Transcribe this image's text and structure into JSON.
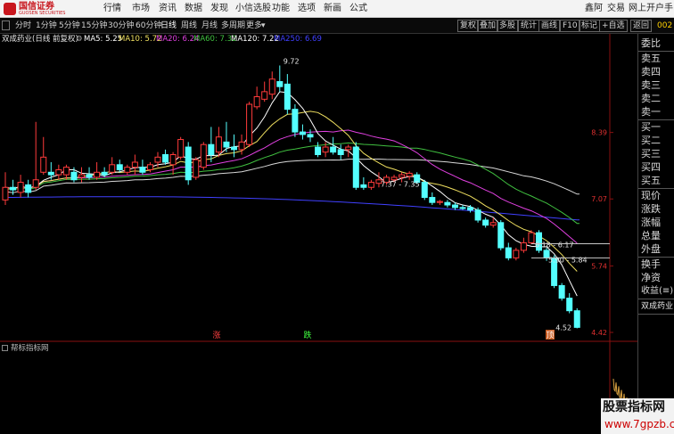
{
  "app": {
    "logo_text": "国信证券",
    "logo_sub": "GUOSEN SECURITIES",
    "menu": [
      "行情",
      "市场",
      "资讯",
      "数据",
      "发现",
      "小信选股",
      "功能",
      "选项",
      "新画",
      "公式"
    ],
    "menu_right": [
      "鑫阿",
      "交易",
      "网上开户",
      "手"
    ]
  },
  "toolbar": {
    "periods": [
      "分时",
      "1分钟",
      "5分钟",
      "15分钟",
      "30分钟",
      "60分钟",
      "日线",
      "周线",
      "月线",
      "多周期",
      "更多"
    ],
    "active_period": "日线",
    "buttons": [
      "复权",
      "叠加",
      "多股",
      "统计",
      "画线",
      "F10",
      "标记",
      "+自选",
      "返回"
    ],
    "code": "002"
  },
  "legend": {
    "title": "双成药业(日线 前复权)",
    "ma": [
      {
        "text": "MA5: 5.25",
        "color": "#ffffff"
      },
      {
        "text": "MA10: 5.72",
        "color": "#f0e060"
      },
      {
        "text": "MA20: 6.24",
        "color": "#e040e0"
      },
      {
        "text": "MA60: 7.32",
        "color": "#40c040"
      },
      {
        "text": "MA120: 7.22",
        "color": "#ffffff"
      },
      {
        "text": "MA250: 6.69",
        "color": "#4040ff"
      }
    ]
  },
  "chart_data": {
    "type": "candlestick",
    "ylim": [
      4.42,
      10.1
    ],
    "y_ticks": [
      "8.39",
      "7.07",
      "5.74",
      "4.42"
    ],
    "candles": [
      {
        "o": 7.05,
        "h": 7.6,
        "l": 6.95,
        "c": 7.3
      },
      {
        "o": 7.3,
        "h": 7.45,
        "l": 7.15,
        "c": 7.25
      },
      {
        "o": 7.2,
        "h": 7.55,
        "l": 7.1,
        "c": 7.4
      },
      {
        "o": 7.35,
        "h": 7.45,
        "l": 7.1,
        "c": 7.2
      },
      {
        "o": 7.3,
        "h": 8.6,
        "l": 7.25,
        "c": 7.45
      },
      {
        "o": 7.6,
        "h": 8.3,
        "l": 7.55,
        "c": 7.9
      },
      {
        "o": 7.6,
        "h": 7.8,
        "l": 7.45,
        "c": 7.55
      },
      {
        "o": 7.55,
        "h": 7.75,
        "l": 7.45,
        "c": 7.65
      },
      {
        "o": 7.55,
        "h": 7.75,
        "l": 7.45,
        "c": 7.7
      },
      {
        "o": 7.6,
        "h": 7.7,
        "l": 7.4,
        "c": 7.45
      },
      {
        "o": 7.5,
        "h": 7.7,
        "l": 7.4,
        "c": 7.55
      },
      {
        "o": 7.55,
        "h": 7.7,
        "l": 7.45,
        "c": 7.5
      },
      {
        "o": 7.5,
        "h": 7.8,
        "l": 7.45,
        "c": 7.6
      },
      {
        "o": 7.6,
        "h": 7.7,
        "l": 7.5,
        "c": 7.55
      },
      {
        "o": 7.6,
        "h": 7.9,
        "l": 7.55,
        "c": 7.75
      },
      {
        "o": 7.75,
        "h": 7.85,
        "l": 7.6,
        "c": 7.65
      },
      {
        "o": 7.6,
        "h": 7.75,
        "l": 7.55,
        "c": 7.7
      },
      {
        "o": 7.7,
        "h": 7.95,
        "l": 7.55,
        "c": 7.8
      },
      {
        "o": 7.7,
        "h": 7.85,
        "l": 7.55,
        "c": 7.6
      },
      {
        "o": 7.65,
        "h": 7.8,
        "l": 7.6,
        "c": 7.75
      },
      {
        "o": 7.8,
        "h": 8.0,
        "l": 7.7,
        "c": 7.9
      },
      {
        "o": 7.95,
        "h": 8.05,
        "l": 7.75,
        "c": 7.8
      },
      {
        "o": 7.75,
        "h": 8.0,
        "l": 7.55,
        "c": 7.95
      },
      {
        "o": 7.9,
        "h": 8.3,
        "l": 7.85,
        "c": 8.25
      },
      {
        "o": 8.1,
        "h": 8.2,
        "l": 7.35,
        "c": 7.45
      },
      {
        "o": 7.5,
        "h": 7.9,
        "l": 7.45,
        "c": 7.85
      },
      {
        "o": 7.7,
        "h": 8.2,
        "l": 7.65,
        "c": 8.15
      },
      {
        "o": 8.15,
        "h": 8.5,
        "l": 7.8,
        "c": 7.95
      },
      {
        "o": 8.0,
        "h": 8.5,
        "l": 7.9,
        "c": 8.3
      },
      {
        "o": 8.2,
        "h": 8.6,
        "l": 8.0,
        "c": 8.1
      },
      {
        "o": 8.1,
        "h": 8.35,
        "l": 7.9,
        "c": 8.05
      },
      {
        "o": 8.05,
        "h": 8.35,
        "l": 7.95,
        "c": 8.2
      },
      {
        "o": 8.15,
        "h": 9.0,
        "l": 8.1,
        "c": 8.95
      },
      {
        "o": 8.9,
        "h": 9.3,
        "l": 8.85,
        "c": 9.1
      },
      {
        "o": 9.05,
        "h": 9.4,
        "l": 9.0,
        "c": 9.2
      },
      {
        "o": 9.15,
        "h": 9.6,
        "l": 9.05,
        "c": 9.45
      },
      {
        "o": 9.4,
        "h": 9.72,
        "l": 9.2,
        "c": 9.3
      },
      {
        "o": 9.35,
        "h": 9.55,
        "l": 8.75,
        "c": 8.85
      },
      {
        "o": 8.85,
        "h": 8.95,
        "l": 8.3,
        "c": 8.4
      },
      {
        "o": 8.4,
        "h": 8.55,
        "l": 8.25,
        "c": 8.35
      },
      {
        "o": 8.35,
        "h": 8.45,
        "l": 8.2,
        "c": 8.3
      },
      {
        "o": 8.1,
        "h": 8.2,
        "l": 7.9,
        "c": 7.95
      },
      {
        "o": 8.0,
        "h": 8.2,
        "l": 7.9,
        "c": 8.1
      },
      {
        "o": 8.1,
        "h": 8.3,
        "l": 7.95,
        "c": 8.0
      },
      {
        "o": 8.05,
        "h": 8.15,
        "l": 7.85,
        "c": 7.95
      },
      {
        "o": 8.05,
        "h": 8.15,
        "l": 7.9,
        "c": 8.1
      },
      {
        "o": 8.1,
        "h": 8.2,
        "l": 7.25,
        "c": 7.3
      },
      {
        "o": 7.35,
        "h": 7.5,
        "l": 7.25,
        "c": 7.3
      },
      {
        "o": 7.3,
        "h": 7.45,
        "l": 7.25,
        "c": 7.4
      },
      {
        "o": 7.38,
        "h": 7.6,
        "l": 7.3,
        "c": 7.45
      },
      {
        "o": 7.4,
        "h": 7.55,
        "l": 7.35,
        "c": 7.5
      },
      {
        "o": 7.45,
        "h": 7.55,
        "l": 7.4,
        "c": 7.5
      },
      {
        "o": 7.5,
        "h": 7.6,
        "l": 7.4,
        "c": 7.55
      },
      {
        "o": 7.52,
        "h": 7.62,
        "l": 7.45,
        "c": 7.58
      },
      {
        "o": 7.55,
        "h": 7.6,
        "l": 7.37,
        "c": 7.4
      },
      {
        "o": 7.4,
        "h": 7.45,
        "l": 7.05,
        "c": 7.1
      },
      {
        "o": 7.1,
        "h": 7.2,
        "l": 6.95,
        "c": 7.0
      },
      {
        "o": 7.0,
        "h": 7.05,
        "l": 6.95,
        "c": 7.02
      },
      {
        "o": 7.0,
        "h": 7.05,
        "l": 6.9,
        "c": 6.95
      },
      {
        "o": 6.95,
        "h": 7.0,
        "l": 6.85,
        "c": 6.9
      },
      {
        "o": 6.9,
        "h": 6.95,
        "l": 6.85,
        "c": 6.88
      },
      {
        "o": 6.9,
        "h": 6.95,
        "l": 6.8,
        "c": 6.85
      },
      {
        "o": 6.85,
        "h": 6.9,
        "l": 6.6,
        "c": 6.65
      },
      {
        "o": 6.65,
        "h": 6.7,
        "l": 6.5,
        "c": 6.55
      },
      {
        "o": 6.55,
        "h": 6.7,
        "l": 6.5,
        "c": 6.6
      },
      {
        "o": 6.6,
        "h": 6.65,
        "l": 6.05,
        "c": 6.1
      },
      {
        "o": 6.1,
        "h": 6.2,
        "l": 5.85,
        "c": 5.9
      },
      {
        "o": 5.9,
        "h": 6.1,
        "l": 5.85,
        "c": 6.05
      },
      {
        "o": 6.05,
        "h": 6.3,
        "l": 6.0,
        "c": 6.2
      },
      {
        "o": 6.2,
        "h": 6.45,
        "l": 6.17,
        "c": 6.4
      },
      {
        "o": 6.4,
        "h": 6.45,
        "l": 6.0,
        "c": 6.05
      },
      {
        "o": 6.05,
        "h": 6.1,
        "l": 5.84,
        "c": 5.9
      },
      {
        "o": 5.9,
        "h": 5.95,
        "l": 5.3,
        "c": 5.35
      },
      {
        "o": 5.35,
        "h": 5.4,
        "l": 5.05,
        "c": 5.1
      },
      {
        "o": 5.1,
        "h": 5.2,
        "l": 4.8,
        "c": 4.85
      },
      {
        "o": 4.85,
        "h": 4.9,
        "l": 4.5,
        "c": 4.52
      }
    ],
    "annotations": [
      {
        "text": "9.72"
      },
      {
        "text": "7.37 - 7.35"
      },
      {
        "text": "6.18 - 6.17"
      },
      {
        "text": "5.90 - 5.84"
      },
      {
        "text": "4.52"
      }
    ],
    "signals": [
      {
        "text": "涨",
        "color": "#ff4040"
      },
      {
        "text": "跌",
        "color": "#40ff40"
      },
      {
        "text": "顶",
        "color": "#ffffff",
        "bg": "#c85a20"
      }
    ]
  },
  "right_panel": {
    "items": [
      "委比",
      "卖五",
      "卖四",
      "卖三",
      "卖二",
      "卖一",
      "买一",
      "买二",
      "买三",
      "买四",
      "买五",
      "现价",
      "涨跌",
      "涨幅",
      "总量",
      "外盘",
      "换手",
      "净资",
      "收益(≡)"
    ],
    "stock_name": "双成药业"
  },
  "indicator": {
    "title": "帮标指标网"
  },
  "watermark": {
    "title": "股票指标网",
    "url": "www.7gpzb.com"
  }
}
